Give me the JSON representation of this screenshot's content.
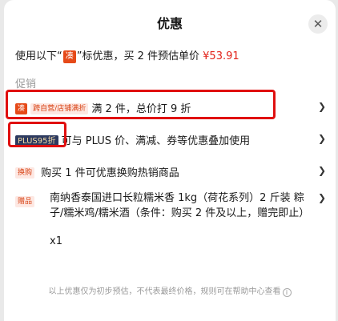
{
  "header": {
    "title": "优惠",
    "close_glyph": "✕"
  },
  "summary": {
    "prefix": "使用以下“",
    "brand_badge": "凑",
    "mid": "”标优惠，买 2 件预估单价 ",
    "price": "¥53.91"
  },
  "section_label": "促销",
  "promotions": [
    {
      "badge": "凑",
      "tag": "跨自营/店铺满折",
      "text": "满 2 件，总价打 9 折"
    },
    {
      "tag": "PLUS95折",
      "text": "可与 PLUS 价、满减、券等优惠叠加使用"
    },
    {
      "tag": "换购",
      "text": "购买 1 件可优惠换购热销商品"
    }
  ],
  "gift": {
    "tag": "赠品",
    "text": "南纳香泰国进口长粒糯米香 1kg（荷花系列）2 斤装 粽子/糯米鸡/糯米酒（条件：购买 2 件及以上，赠完即止）",
    "quantity": "x1"
  },
  "footer_note": "以上优惠仅为初步预估，不代表最终价格，规则可在帮助中心查看",
  "icons": {
    "chevron": "chevron-right-icon",
    "close": "close-icon",
    "info": "info-icon"
  },
  "colors": {
    "accent_red": "#e64a19",
    "price_red": "#e2231a",
    "plus_navy": "#2d3a5f",
    "highlight_box": "#e00f0f"
  }
}
